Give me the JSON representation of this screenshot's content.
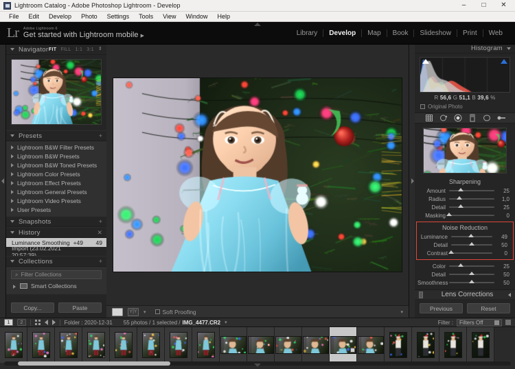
{
  "window": {
    "title": "Lightroom Catalog - Adobe Photoshop Lightroom - Develop",
    "app_icon": "lightroom-icon",
    "minimize": "–",
    "maximize": "□",
    "close": "✕"
  },
  "menubar": [
    {
      "label": "File"
    },
    {
      "label": "Edit"
    },
    {
      "label": "Develop"
    },
    {
      "label": "Photo"
    },
    {
      "label": "Settings"
    },
    {
      "label": "Tools"
    },
    {
      "label": "View"
    },
    {
      "label": "Window"
    },
    {
      "label": "Help"
    }
  ],
  "identity": {
    "logo": "Lr",
    "subtitle": "Adobe Lightroom 6",
    "title": "Get started with Lightroom mobile",
    "arrow": "▶"
  },
  "modules": [
    {
      "label": "Library",
      "active": false
    },
    {
      "label": "Develop",
      "active": true
    },
    {
      "label": "Map",
      "active": false
    },
    {
      "label": "Book",
      "active": false
    },
    {
      "label": "Slideshow",
      "active": false
    },
    {
      "label": "Print",
      "active": false
    },
    {
      "label": "Web",
      "active": false
    }
  ],
  "left_panel": {
    "navigator": {
      "title": "Navigator",
      "zoom_levels": [
        {
          "label": "FIT",
          "active": true
        },
        {
          "label": "FILL",
          "active": false
        },
        {
          "label": "1:1",
          "active": false
        },
        {
          "label": "3:1",
          "active": false
        }
      ],
      "stepper": "⇕"
    },
    "presets": {
      "title": "Presets",
      "add_label": "+",
      "items": [
        "Lightroom B&W Filter Presets",
        "Lightroom B&W Presets",
        "Lightroom B&W Toned Presets",
        "Lightroom Color Presets",
        "Lightroom Effect Presets",
        "Lightroom General Presets",
        "Lightroom Video Presets",
        "User Presets"
      ]
    },
    "snapshots": {
      "title": "Snapshots",
      "add_label": "+"
    },
    "history": {
      "title": "History",
      "clear_label": "✕",
      "items": [
        {
          "label": "Luminance Smoothing",
          "delta": "+49",
          "value": "49",
          "selected": true
        },
        {
          "label": "Import (23.02.2021 20:57:39)",
          "delta": "",
          "value": "",
          "selected": false
        }
      ]
    },
    "collections": {
      "title": "Collections",
      "add_label": "+",
      "filter_placeholder": "Filter Collections",
      "items": [
        {
          "label": "Smart Collections"
        }
      ]
    },
    "copy_label": "Copy...",
    "paste_label": "Paste"
  },
  "toolbar": {
    "view_icon": "loupe-view-icon",
    "before_after_icon": "before-after-icon",
    "caret": "▾",
    "soft_proofing_label": "Soft Proofing",
    "right_caret": "▾"
  },
  "right_panel": {
    "histogram": {
      "title": "Histogram",
      "r_label": "R",
      "r_value": "56,6",
      "g_label": "G",
      "g_value": "51,1",
      "b_label": "B",
      "b_value": "39,6",
      "unit": "%",
      "original_photo_label": "Original Photo"
    },
    "tools": [
      "crop-overlay-icon",
      "spot-removal-icon",
      "red-eye-icon",
      "graduated-filter-icon",
      "radial-filter-icon",
      "adjustment-brush-icon"
    ],
    "detail": {
      "sharpening_title": "Sharpening",
      "sharpening": [
        {
          "label": "Amount",
          "value": "25",
          "pos": 25
        },
        {
          "label": "Radius",
          "value": "1,0",
          "pos": 22
        },
        {
          "label": "Detail",
          "value": "25",
          "pos": 25
        },
        {
          "label": "Masking",
          "value": "0",
          "pos": 0
        }
      ],
      "noise_title": "Noise Reduction",
      "noise_luminance": [
        {
          "label": "Luminance",
          "value": "49",
          "pos": 49
        },
        {
          "label": "Detail",
          "value": "50",
          "pos": 50
        },
        {
          "label": "Contrast",
          "value": "0",
          "pos": 0
        }
      ],
      "noise_color": [
        {
          "label": "Color",
          "value": "25",
          "pos": 25
        },
        {
          "label": "Detail",
          "value": "50",
          "pos": 50
        },
        {
          "label": "Smoothness",
          "value": "50",
          "pos": 50
        }
      ],
      "highlight_color": "#e0483c"
    },
    "lens_corrections_title": "Lens Corrections",
    "previous_label": "Previous",
    "reset_label": "Reset"
  },
  "filmstrip": {
    "page_1": "1",
    "page_2": "2",
    "grid_icon": "grid-view-icon",
    "back_icon": "arrow-left-icon",
    "forward_icon": "arrow-right-icon",
    "folder_label": "Folder : 2020-12-31",
    "photo_count": "55 photos / 1 selected /",
    "filename": "IMG_4477.CR2",
    "filename_caret": "▾",
    "filter_label": "Filter :",
    "filter_value": "Filters Off",
    "thumbnails": [
      {
        "type": "portrait",
        "selected": false
      },
      {
        "type": "portrait",
        "selected": false
      },
      {
        "type": "portrait",
        "selected": false
      },
      {
        "type": "portrait",
        "selected": false
      },
      {
        "type": "portrait",
        "selected": false
      },
      {
        "type": "portrait",
        "selected": false
      },
      {
        "type": "portrait",
        "selected": false
      },
      {
        "type": "portrait",
        "selected": false
      },
      {
        "type": "landscape",
        "selected": false
      },
      {
        "type": "landscape",
        "selected": false
      },
      {
        "type": "landscape",
        "selected": false
      },
      {
        "type": "landscape",
        "selected": false
      },
      {
        "type": "landscape",
        "selected": true
      },
      {
        "type": "landscape",
        "selected": false
      },
      {
        "type": "portrait",
        "selected": false
      },
      {
        "type": "portrait",
        "selected": false
      },
      {
        "type": "portrait",
        "selected": false
      },
      {
        "type": "portrait",
        "selected": false
      }
    ]
  }
}
